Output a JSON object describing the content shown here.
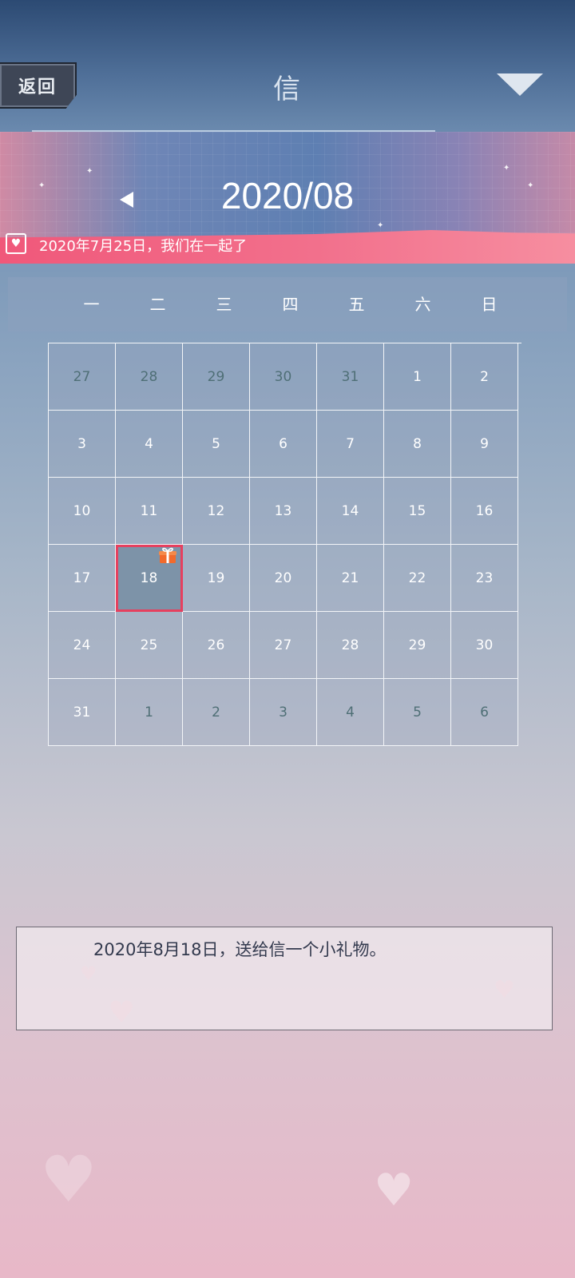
{
  "header": {
    "back_label": "返回",
    "title": "信",
    "dropdown_icon": "triangle-down-icon"
  },
  "banner": {
    "month": "2020/08",
    "prev_icon": "triangle-left-icon",
    "anniversary_icon": "heart-calendar-icon",
    "anniversary_text": "2020年7月25日，我们在一起了"
  },
  "calendar": {
    "weekdays": [
      "一",
      "二",
      "三",
      "四",
      "五",
      "六",
      "日"
    ],
    "rows": [
      [
        "27",
        "28",
        "29",
        "30",
        "31",
        "1",
        "2"
      ],
      [
        "3",
        "4",
        "5",
        "6",
        "7",
        "8",
        "9"
      ],
      [
        "10",
        "11",
        "12",
        "13",
        "14",
        "15",
        "16"
      ],
      [
        "17",
        "18",
        "19",
        "20",
        "21",
        "22",
        "23"
      ],
      [
        "24",
        "25",
        "26",
        "27",
        "28",
        "29",
        "30"
      ],
      [
        "31",
        "1",
        "2",
        "3",
        "4",
        "5",
        "6"
      ]
    ],
    "selected_day": "18",
    "gift_icon": "gift-icon"
  },
  "note": {
    "text": "2020年8月18日，送给信一个小礼物。"
  },
  "colors": {
    "accent": "#e6405f",
    "ribbon": "#f0587a",
    "other_month_text": "#4f6f76"
  }
}
